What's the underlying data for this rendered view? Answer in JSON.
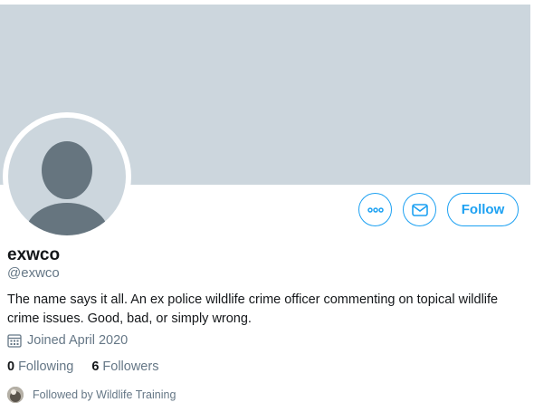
{
  "profile": {
    "display_name": "exwco",
    "handle": "@exwco",
    "bio": "The name says it all. An ex police wildlife crime officer commenting on topical wildlife crime issues. Good, bad, or simply wrong.",
    "joined": "Joined April 2020",
    "following_count": "0",
    "following_label": "Following",
    "followers_count": "6",
    "followers_label": "Followers",
    "followed_by": "Followed by Wildlife Training"
  },
  "actions": {
    "more_icon": "more-icon",
    "message_icon": "envelope-icon",
    "follow_label": "Follow"
  },
  "colors": {
    "accent": "#1da1f2",
    "banner": "#ccd6dd",
    "avatar_silhouette": "#66757f",
    "muted_text": "#657786"
  }
}
